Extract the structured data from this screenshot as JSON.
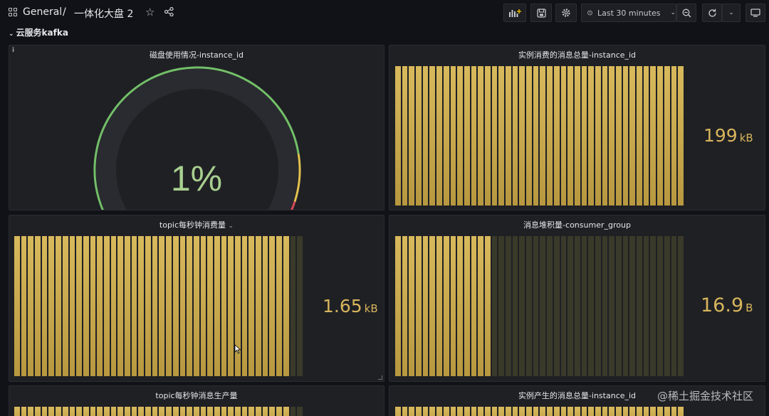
{
  "nav": {
    "breadcrumb_folder": "General",
    "separator": "/",
    "dashboard_title": "一体化大盘 2",
    "time_range": "Last 30 minutes",
    "icons": {
      "apps": "grid-icon",
      "star": "star-icon",
      "share": "share-icon",
      "add_panel": "add-panel-icon",
      "save": "save-icon",
      "settings": "gear-icon",
      "clock": "clock-icon",
      "zoom_out": "zoom-out-icon",
      "refresh": "refresh-icon",
      "refresh_interval": "chevron-down-icon",
      "tv_mode": "monitor-icon"
    }
  },
  "row": {
    "title": "云服务kafka"
  },
  "panels": {
    "disk": {
      "title": "磁盘使用情况-instance_id",
      "value": "1%",
      "percent": 1,
      "info": "i"
    },
    "consumed_total": {
      "title": "实例消费的消息总量-instance_id",
      "value": "199",
      "unit": "kB",
      "bar_count": 42,
      "active_bars": 42
    },
    "topic_consume": {
      "title": "topic每秒钟消费量",
      "value": "1.65",
      "unit": "kB",
      "bar_count": 42,
      "active_bars": 40
    },
    "lag": {
      "title": "消息堆积量-consumer_group",
      "value": "16.9",
      "unit": "B",
      "bar_count": 42,
      "active_bars": 14
    },
    "topic_produce": {
      "title": "topic每秒钟消息生产量"
    },
    "produced_total": {
      "title": "实例产生的消息总量-instance_id"
    }
  },
  "colors": {
    "bar_active": "#c9a94e",
    "bar_inactive": "#3a3a2a",
    "stat_text": "#d7b55c",
    "gauge_green": "#73bf69",
    "gauge_yellow": "#e3c24f",
    "gauge_red": "#d44a5a",
    "background": "#111217",
    "panel": "#1f2024"
  },
  "watermark": "@稀土掘金技术社区"
}
